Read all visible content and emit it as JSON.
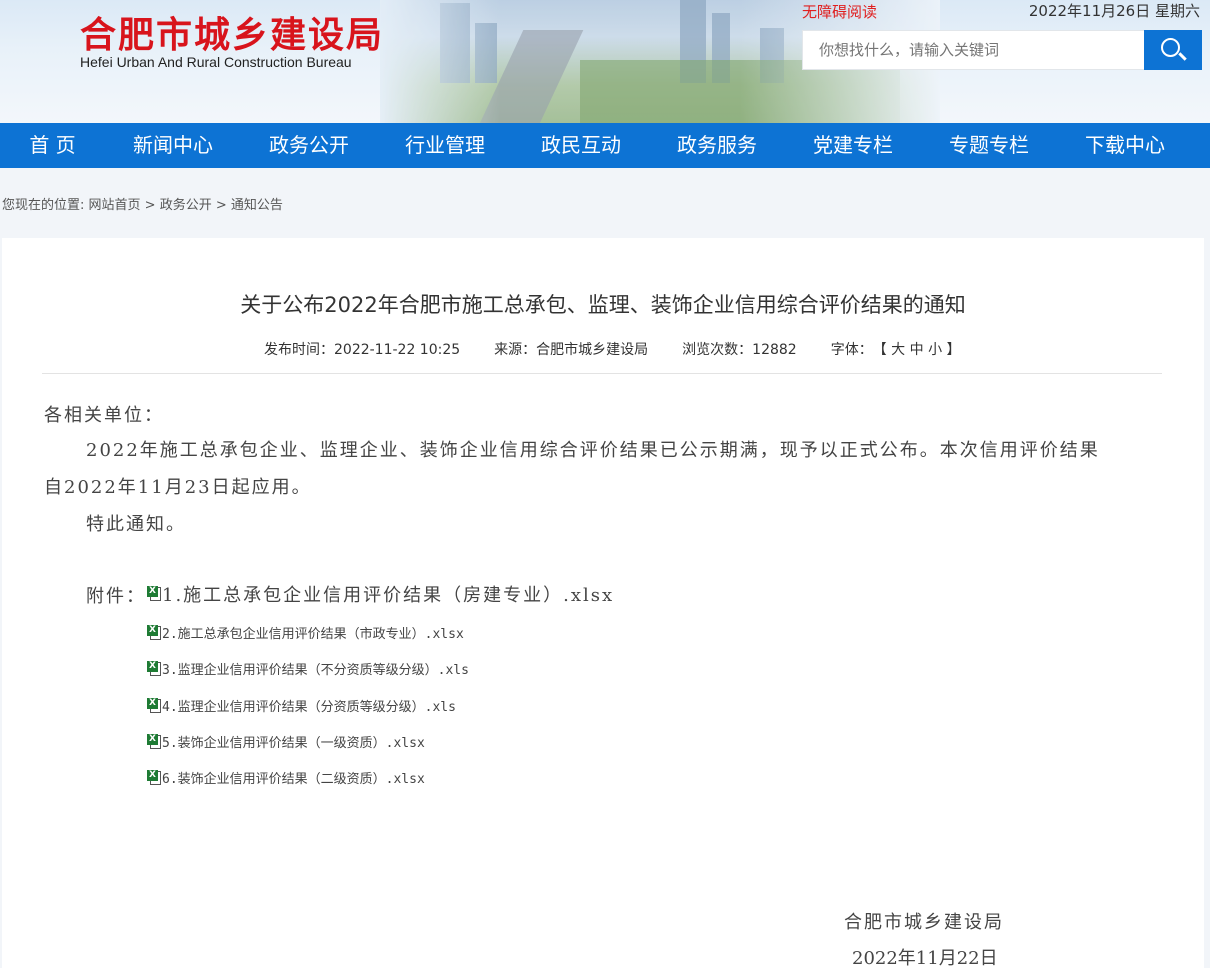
{
  "header": {
    "logo_cn": "合肥市城乡建设局",
    "logo_en": "Hefei Urban And Rural Construction Bureau",
    "accessibility_link": "无障碍阅读",
    "date": "2022年11月26日 星期六",
    "search_placeholder": "你想找什么，请输入关键词"
  },
  "nav": {
    "items": [
      "首 页",
      "新闻中心",
      "政务公开",
      "行业管理",
      "政民互动",
      "政务服务",
      "党建专栏",
      "专题专栏",
      "下载中心"
    ]
  },
  "breadcrumb": {
    "prefix": "您现在的位置:",
    "items": [
      "网站首页",
      "政务公开",
      "通知公告"
    ],
    "separator": " > "
  },
  "article": {
    "title": "关于公布2022年合肥市施工总承包、监理、装饰企业信用综合评价结果的通知",
    "publish_time": "发布时间：2022-11-22 10:25",
    "source": "来源：合肥市城乡建设局",
    "views": "浏览次数：12882",
    "font_size_label": "字体：",
    "font_size_options": "【 大 中 小 】",
    "salutation": "各相关单位：",
    "paragraph1_line1": "2022年施工总承包企业、监理企业、装饰企业信用综合评价结果已公示期满，现予以正式公布。本次信用评价结果",
    "paragraph1_line2": "自2022年11月23日起应用。",
    "notice": "特此通知。",
    "attachments_label": "附件：",
    "attachments": [
      "1.施工总承包企业信用评价结果（房建专业）.xlsx",
      "2.施工总承包企业信用评价结果（市政专业）.xlsx",
      "3.监理企业信用评价结果（不分资质等级分级）.xls",
      "4.监理企业信用评价结果（分资质等级分级）.xls",
      "5.装饰企业信用评价结果（一级资质）.xlsx",
      "6.装饰企业信用评价结果（二级资质）.xlsx"
    ],
    "signature_org": "合肥市城乡建设局",
    "signature_date": "2022年11月22日"
  },
  "colors": {
    "brand_blue": "#0d73d4",
    "logo_red": "#d8141c"
  }
}
